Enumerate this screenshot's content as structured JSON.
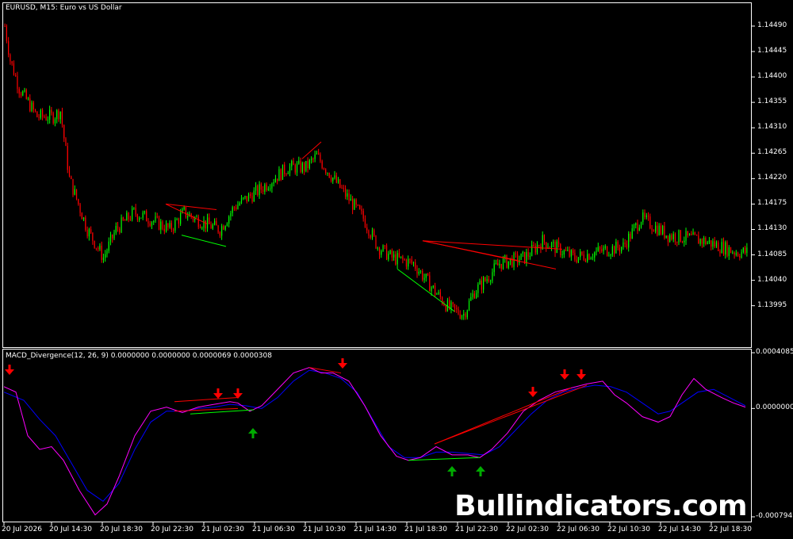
{
  "chart_title": "EURUSD, M15:  Euro vs US Dollar",
  "indicator_title": "MACD_Divergence(12, 26, 9) 0.0000000 0.0000000 0.0000069 0.0000308",
  "watermark": "Bullindicators.com",
  "chart_data": [
    {
      "type": "candlestick",
      "title": "EURUSD, M15:  Euro vs US Dollar",
      "ylim": [
        1.1393,
        1.14525
      ],
      "y_ticks": [
        "1.14490",
        "1.14445",
        "1.14400",
        "1.14355",
        "1.14310",
        "1.14265",
        "1.14220",
        "1.14175",
        "1.14130",
        "1.14085",
        "1.14040",
        "1.13995"
      ],
      "series": [
        {
          "name": "",
          "color": "#00ff00",
          "role": "bull"
        },
        {
          "name": "",
          "color": "#ff0000",
          "role": "bear"
        }
      ],
      "trend_lines_price": [
        {
          "color": "#ff0000",
          "from": [
            "20 Jul 23:15",
            1.14175
          ],
          "to": [
            "21 Jul 03:15",
            1.14165
          ]
        },
        {
          "color": "#ff0000",
          "from": [
            "20 Jul 23:15",
            1.14175
          ],
          "to": [
            "21 Jul 02:30",
            1.1414
          ]
        },
        {
          "color": "#00ff00",
          "from": [
            "21 Jul 00:30",
            1.1412
          ],
          "to": [
            "21 Jul 04:00",
            1.141
          ]
        },
        {
          "color": "#ff0000",
          "from": [
            "21 Jul 10:00",
            1.14255
          ],
          "to": [
            "21 Jul 11:30",
            1.14285
          ]
        },
        {
          "color": "#ff0000",
          "from": [
            "21 Jul 19:30",
            1.1411
          ],
          "to": [
            "22 Jul 06:30",
            1.14095
          ]
        },
        {
          "color": "#ff0000",
          "from": [
            "21 Jul 19:30",
            1.1411
          ],
          "to": [
            "22 Jul 03:00",
            1.14075
          ]
        },
        {
          "color": "#ff0000",
          "from": [
            "21 Jul 19:30",
            1.1411
          ],
          "to": [
            "22 Jul 06:00",
            1.1406
          ]
        },
        {
          "color": "#00ff00",
          "from": [
            "21 Jul 17:30",
            1.1406
          ],
          "to": [
            "21 Jul 22:00",
            1.13985
          ]
        }
      ]
    },
    {
      "type": "line",
      "title": "MACD_Divergence(12, 26, 9) 0.0000000 0.0000000 0.0000069 0.0000308",
      "ylim": [
        -0.0007941,
        0.0004085
      ],
      "y_ticks": [
        "0.0004085",
        "0.0000000",
        "-0.0007941"
      ],
      "series": [
        {
          "name": "",
          "color": "#ff00ff"
        },
        {
          "name": "",
          "color": "#0000ff"
        }
      ],
      "arrows": [
        {
          "direction": "down",
          "color": "#ff0000",
          "time": "20 Jul 10:45"
        },
        {
          "direction": "down",
          "color": "#ff0000",
          "time": "21 Jul 01:30"
        },
        {
          "direction": "down",
          "color": "#ff0000",
          "time": "21 Jul 03:00"
        },
        {
          "direction": "up",
          "color": "#00aa00",
          "time": "21 Jul 04:00"
        },
        {
          "direction": "down",
          "color": "#ff0000",
          "time": "21 Jul 11:30"
        },
        {
          "direction": "up",
          "color": "#00aa00",
          "time": "21 Jul 21:00"
        },
        {
          "direction": "up",
          "color": "#00aa00",
          "time": "21 Jul 23:15"
        },
        {
          "direction": "down",
          "color": "#ff0000",
          "time": "22 Jul 03:30"
        },
        {
          "direction": "down",
          "color": "#ff0000",
          "time": "22 Jul 05:45"
        },
        {
          "direction": "down",
          "color": "#ff0000",
          "time": "22 Jul 07:00"
        }
      ]
    }
  ],
  "x_ticks": [
    "20 Jul 2026",
    "20 Jul 14:30",
    "20 Jul 18:30",
    "20 Jul 22:30",
    "21 Jul 02:30",
    "21 Jul 06:30",
    "21 Jul 10:30",
    "21 Jul 14:30",
    "21 Jul 18:30",
    "21 Jul 22:30",
    "22 Jul 02:30",
    "22 Jul 06:30",
    "22 Jul 10:30",
    "22 Jul 14:30",
    "22 Jul 18:30"
  ],
  "colors": {
    "background": "#000000",
    "grid": "#ffffff",
    "bull": "#00ff00",
    "bear": "#ff0000",
    "macd": "#ff00ff",
    "signal": "#0000ff"
  }
}
